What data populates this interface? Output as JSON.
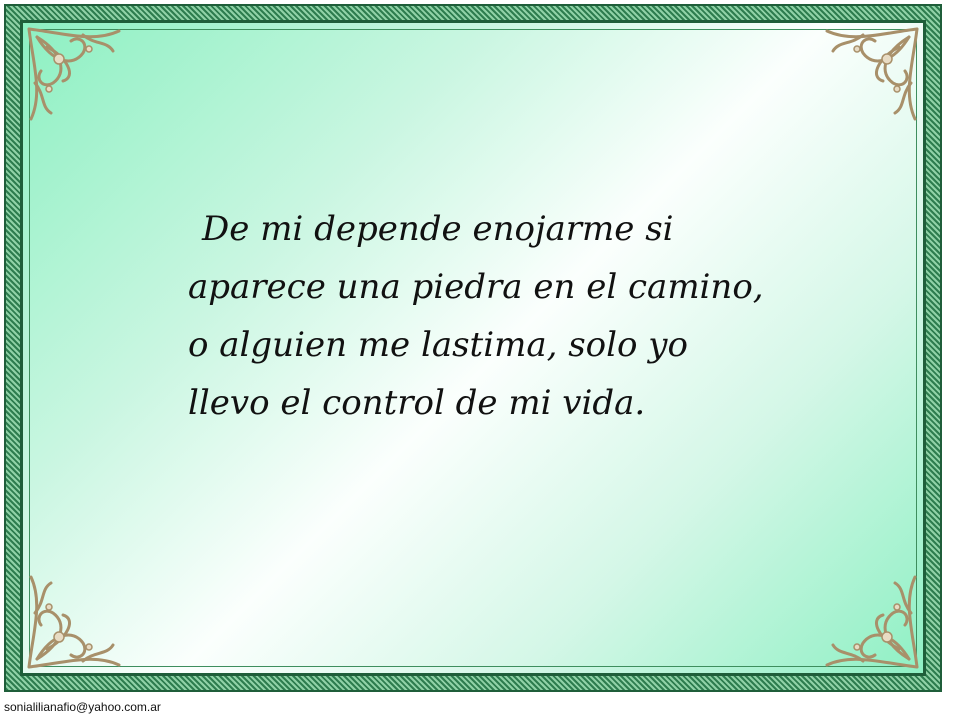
{
  "slide": {
    "quote_lines": [
      "De mi depende enojarme si",
      "aparece una piedra en el camino,",
      "o alguien me lastima, solo yo",
      "llevo el control de mi vida."
    ],
    "footer_email": "sonialilianafio@yahoo.com.ar"
  },
  "colors": {
    "frame_dark": "#1f5e3a",
    "frame_light": "#8fd1a6",
    "background_mint": "#8df0c2",
    "background_center": "#fbfffd",
    "ornament_gold": "#a8906a"
  },
  "icons": {
    "corner_ornament": "filigree-corner-ornament"
  }
}
